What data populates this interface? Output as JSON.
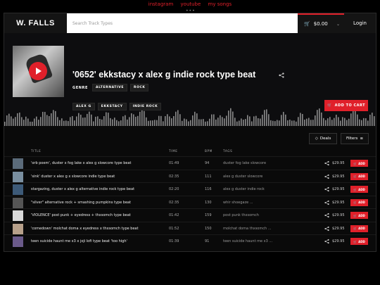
{
  "top_nav": {
    "links": [
      "instagram",
      "youtube",
      "my songs"
    ],
    "dots": "•••"
  },
  "header": {
    "logo": "W. FALLS",
    "search_placeholder": "Search Track Types",
    "cart_total": "$0.00",
    "login": "Login"
  },
  "track": {
    "title": "'0652' ekkstacy x alex g indie rock type beat",
    "genre_label": "GENRE",
    "genres": [
      "ALTERNATIVE",
      "ROCK"
    ],
    "tags": [
      "ALEX G",
      "EKKSTACY",
      "INDIE ROCK"
    ],
    "add_to_cart": "ADD TO CART"
  },
  "list": {
    "deals_label": "Deals",
    "filters_label": "Filters",
    "columns": {
      "title": "TITLE",
      "time": "TIME",
      "bpm": "BPM",
      "tags": "TAGS"
    },
    "add_label": "ADD",
    "rows": [
      {
        "title": "'orb poem', duster x fog lake x alex g slowcore type beat",
        "time": "01:49",
        "bpm": "94",
        "tags": "duster fog lake slowcore",
        "price": "$29.95",
        "thumb_color": "#5b6b7a"
      },
      {
        "title": "'sink' duster x alex g x slowcore indie type beat",
        "time": "02:35",
        "bpm": "111",
        "tags": "alex g  duster  slowcore",
        "price": "$29.95",
        "thumb_color": "#7a8fa0"
      },
      {
        "title": "stargazing, duster x alex g alternative indie rock type beat",
        "time": "02:20",
        "bpm": "116",
        "tags": "alex g  duster  indie rock",
        "price": "$29.95",
        "thumb_color": "#3d5a78"
      },
      {
        "title": "\"silver\" alternative rock + smashing pumpkins type beat",
        "time": "02:35",
        "bpm": "130",
        "tags": "whir  shoegaze  ...",
        "price": "$29.95",
        "thumb_color": "#555555"
      },
      {
        "title": "'VIOLENCE' post punk + eyedress + thxsomch type beat",
        "time": "01:42",
        "bpm": "159",
        "tags": "post punk  thxsomch",
        "price": "$29.95",
        "thumb_color": "#d8d8d8"
      },
      {
        "title": "'comedown' molchat doma x eyedress x thxsomch type beat",
        "time": "01:52",
        "bpm": "150",
        "tags": "molchat doma  thxsomch  ...",
        "price": "$29.95",
        "thumb_color": "#b7a08a"
      },
      {
        "title": "teen suicide haunt me x3 x joji lofi type beat 'too high'",
        "time": "01:39",
        "bpm": "91",
        "tags": "teen suicide  haunt me x3  ...",
        "price": "$29.95",
        "thumb_color": "#6a5a8a"
      }
    ]
  },
  "colors": {
    "accent": "#e0202a",
    "background": "#000000"
  }
}
